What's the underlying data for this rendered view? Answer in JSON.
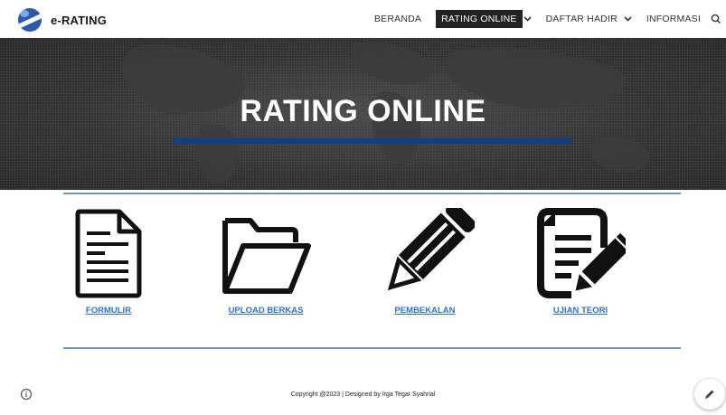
{
  "header": {
    "brand": "e-RATING",
    "nav": {
      "beranda": "BERANDA",
      "rating_online": "RATING ONLINE",
      "daftar_hadir": "DAFTAR HADIR",
      "informasi": "INFORMASI"
    },
    "active_color": "#222222"
  },
  "hero": {
    "title": "RATING ONLINE",
    "accent_color": "#0f3f8c"
  },
  "cards": [
    {
      "label": "FORMULIR",
      "icon": "document-icon"
    },
    {
      "label": "UPLOAD BERKAS",
      "icon": "folder-icon"
    },
    {
      "label": "PEMBEKALAN",
      "icon": "pencil-icon"
    },
    {
      "label": "UJIAN TEORI",
      "icon": "edit-document-icon"
    }
  ],
  "footer": {
    "text": "Copyright @2023 | Designed by Irga Tegar Syahrial"
  },
  "colors": {
    "link": "#2f6fd0",
    "rule": "#6f95c2"
  }
}
